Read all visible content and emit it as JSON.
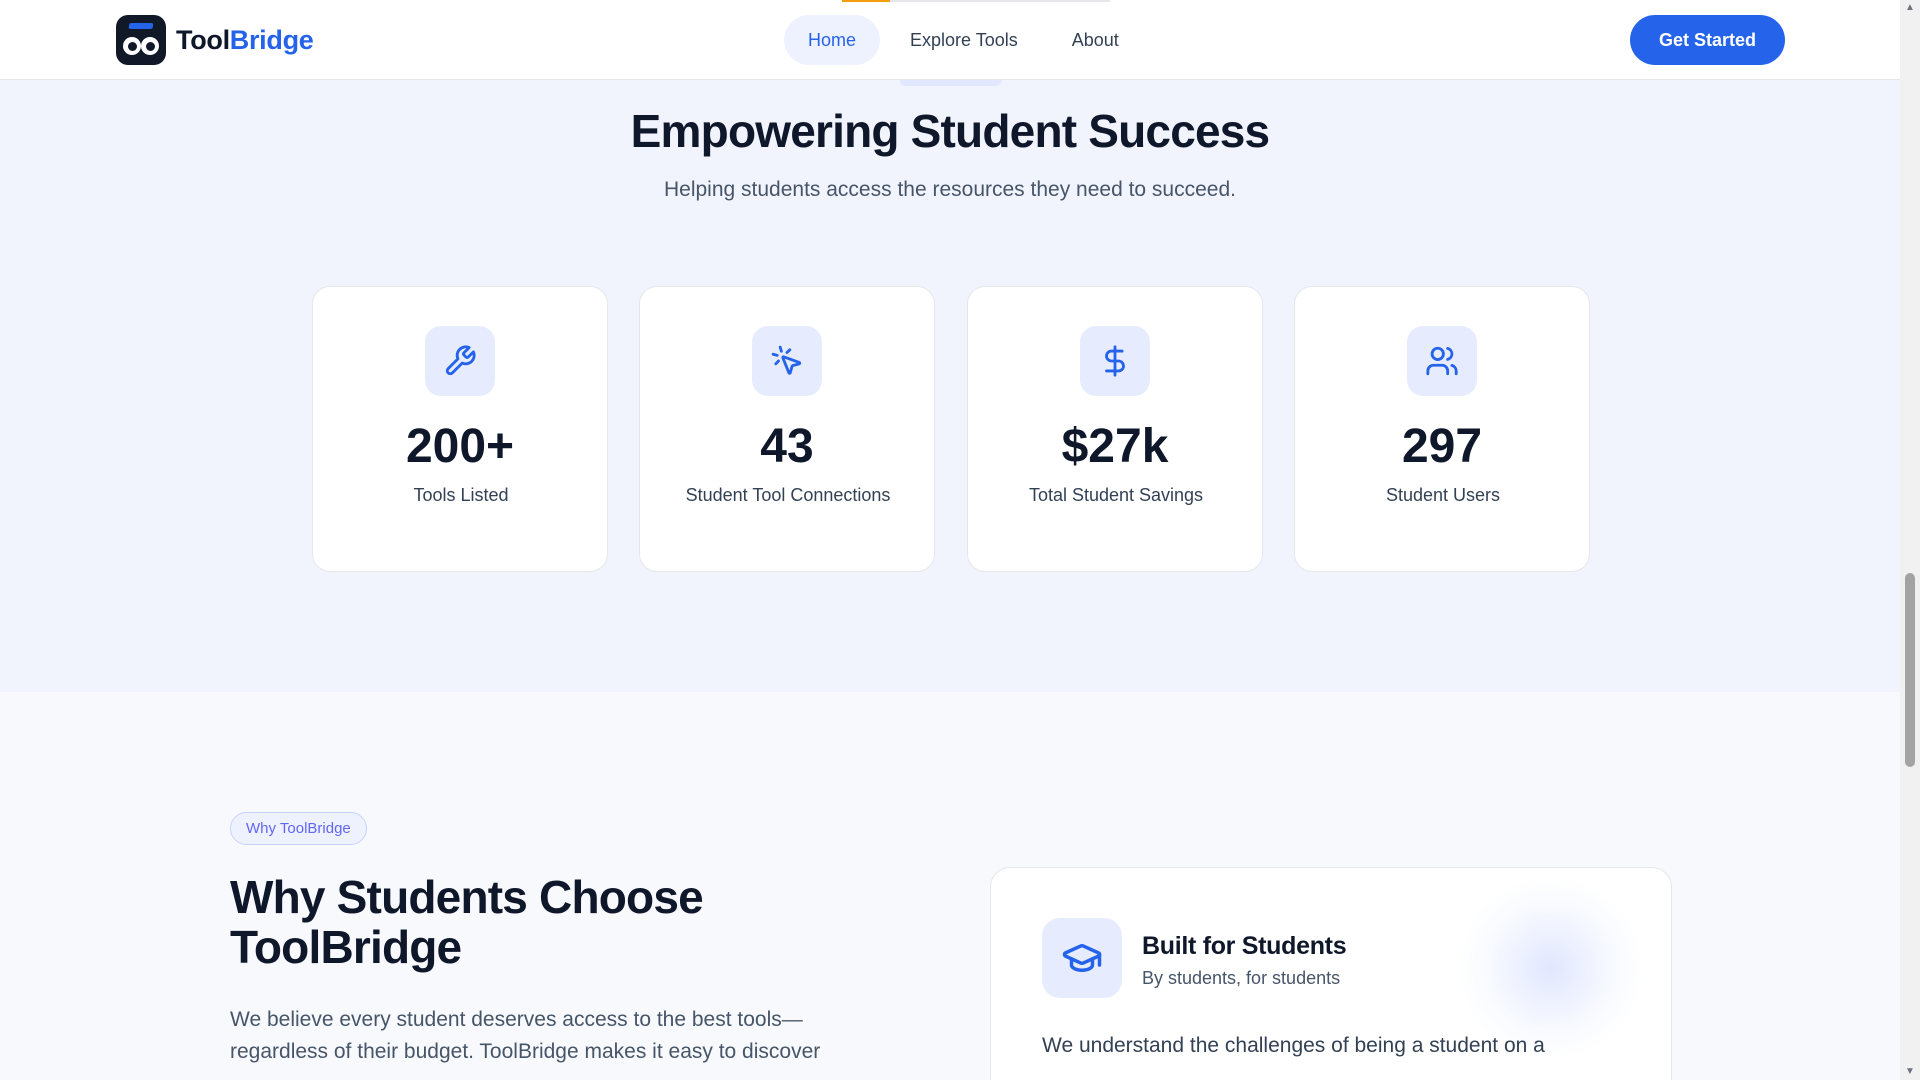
{
  "header": {
    "logo_text_primary": "Tool",
    "logo_text_accent": "Bridge",
    "nav": [
      {
        "label": "Home",
        "active": true
      },
      {
        "label": "Explore Tools",
        "active": false
      },
      {
        "label": "About",
        "active": false
      }
    ],
    "cta_label": "Get Started",
    "scroll_progress_percent": 18
  },
  "stats": {
    "title": "Empowering Student Success",
    "subtitle": "Helping students access the resources they need to succeed.",
    "cards": [
      {
        "icon": "wrench-icon",
        "value": "200+",
        "label": "Tools Listed"
      },
      {
        "icon": "pointer-click-icon",
        "value": "43",
        "label": "Student Tool Connections"
      },
      {
        "icon": "dollar-icon",
        "value": "$27k",
        "label": "Total Student Savings"
      },
      {
        "icon": "users-icon",
        "value": "297",
        "label": "Student Users"
      }
    ]
  },
  "why": {
    "badge": "Why ToolBridge",
    "title": "Why Students Choose ToolBridge",
    "body": "We believe every student deserves access to the best tools—regardless of their budget. ToolBridge makes it easy to discover",
    "feature": {
      "icon": "graduation-cap-icon",
      "title": "Built for Students",
      "subtitle": "By students, for students",
      "body": "We understand the challenges of being a student on a"
    }
  },
  "colors": {
    "accent": "#2563eb",
    "icon_bg": "#e6ecfd",
    "section_bg": "#f1f4fd",
    "progress": "#f59e0b"
  }
}
